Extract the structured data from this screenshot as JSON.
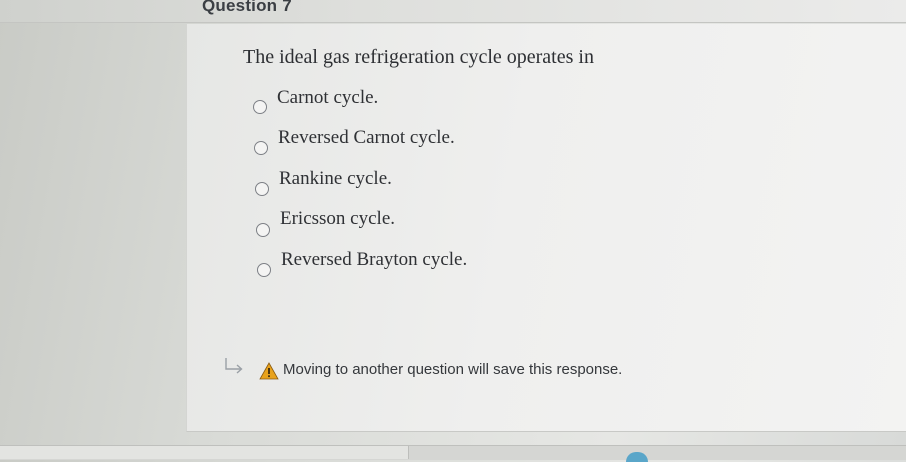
{
  "header": {
    "question_title": "Question 7"
  },
  "question": {
    "text": "The ideal gas refrigeration cycle operates in",
    "options": [
      {
        "label": "Carnot cycle.",
        "selected": false
      },
      {
        "label": "Reversed Carnot cycle.",
        "selected": false
      },
      {
        "label": "Rankine cycle.",
        "selected": false
      },
      {
        "label": "Ericsson cycle.",
        "selected": false
      },
      {
        "label": "Reversed Brayton cycle.",
        "selected": false
      }
    ]
  },
  "notice": {
    "text": "Moving to another question will save this response.",
    "icons": [
      "return-arrow-icon",
      "warning-icon"
    ],
    "warning_color": "#e8a21c"
  }
}
